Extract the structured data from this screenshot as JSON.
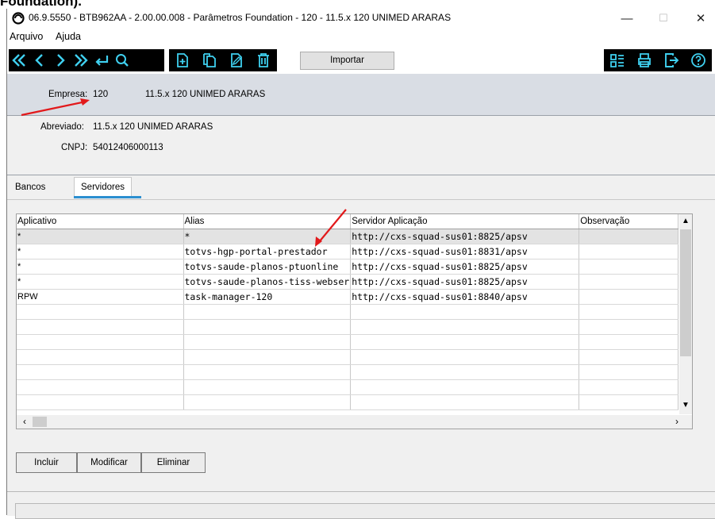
{
  "page_heading": "Foundation).",
  "window": {
    "title": "06.9.5550 - BTB962AA - 2.00.00.008 - Parâmetros Foundation - 120 - 11.5.x 120 UNIMED ARARAS",
    "minimize": "—",
    "maximize": "☐",
    "close": "✕"
  },
  "menu": [
    "Arquivo",
    "Ajuda"
  ],
  "toolbar": {
    "nav_icons": [
      "first-icon",
      "previous-icon",
      "next-icon",
      "last-icon",
      "go-to-icon",
      "search-icon"
    ],
    "record_icons": [
      "add-icon",
      "copy-icon",
      "edit-icon",
      "delete-icon"
    ],
    "import_label": "Importar",
    "right_icons": [
      "list-icon",
      "print-icon",
      "exit-icon",
      "help-icon"
    ],
    "accent": "#3fd0f0"
  },
  "header": {
    "empresa_label": "Empresa:",
    "empresa_code": "120",
    "empresa_name": "11.5.x 120 UNIMED ARARAS"
  },
  "info": {
    "abreviado_label": "Abreviado:",
    "abreviado_value": "11.5.x 120 UNIMED ARARAS",
    "cnpj_label": "CNPJ:",
    "cnpj_value": "54012406000113"
  },
  "tabs": [
    {
      "label": "Bancos",
      "active": false
    },
    {
      "label": "Servidores",
      "active": true
    }
  ],
  "grid": {
    "columns": [
      "Aplicativo",
      "Alias",
      "Servidor Aplicação",
      "Observação"
    ],
    "rows": [
      [
        "*",
        "*",
        "http://cxs-squad-sus01:8825/apsv",
        ""
      ],
      [
        "*",
        "totvs-hgp-portal-prestador",
        "http://cxs-squad-sus01:8831/apsv",
        ""
      ],
      [
        "*",
        "totvs-saude-planos-ptuonline",
        "http://cxs-squad-sus01:8825/apsv",
        ""
      ],
      [
        "*",
        "totvs-saude-planos-tiss-webser",
        "http://cxs-squad-sus01:8825/apsv",
        ""
      ],
      [
        "RPW",
        "task-manager-120",
        "http://cxs-squad-sus01:8840/apsv",
        ""
      ]
    ],
    "empty_rows": 7,
    "selected_row": 0
  },
  "buttons": {
    "incluir": "Incluir",
    "modificar": "Modificar",
    "eliminar": "Eliminar"
  },
  "annotation_color": "#e2191b"
}
